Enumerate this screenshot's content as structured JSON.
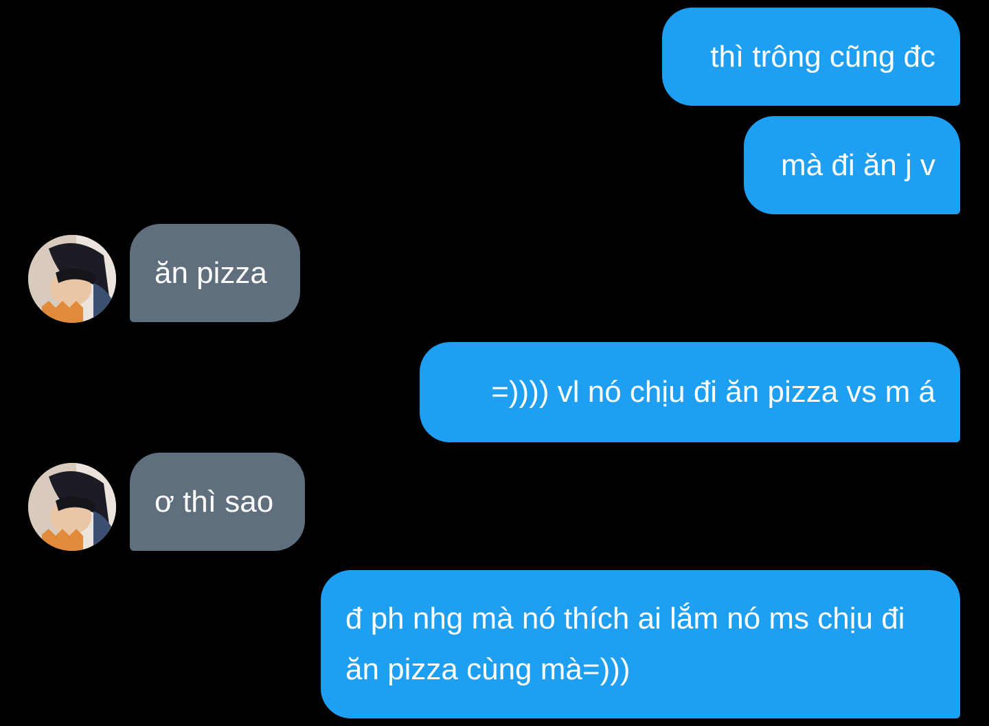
{
  "conversation": {
    "messages": [
      {
        "sender": "me",
        "text": "thì trông cũng đc"
      },
      {
        "sender": "me",
        "text": "mà đi ăn j v"
      },
      {
        "sender": "them",
        "text": "ăn pizza"
      },
      {
        "sender": "me",
        "text": "=)))) vl nó chịu đi ăn pizza vs m á"
      },
      {
        "sender": "them",
        "text": "ơ thì sao"
      },
      {
        "sender": "me",
        "text": "đ ph nhg mà nó thích ai lắm nó ms chịu đi ăn pizza cùng mà=)))"
      }
    ]
  },
  "colors": {
    "background": "#000000",
    "outgoing_bubble": "#1e9ff2",
    "incoming_bubble": "#5f6f7e",
    "text": "#ffffff"
  },
  "icons": {
    "avatar": "contact-avatar-photo"
  }
}
